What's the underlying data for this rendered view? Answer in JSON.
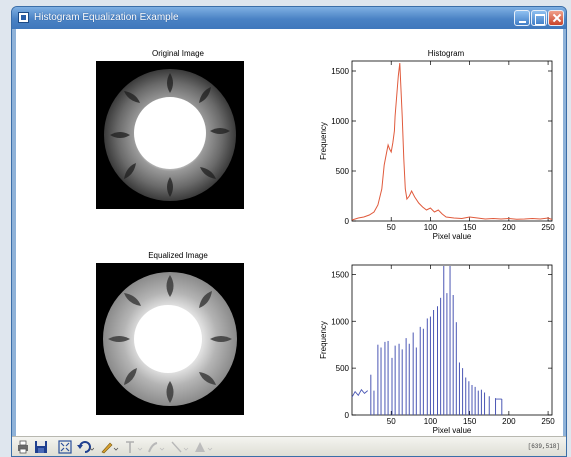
{
  "window": {
    "title": "Histogram Equalization Example",
    "titlebar_color": "#4a82c4"
  },
  "images": {
    "original_title": "Original Image",
    "equalized_title": "Equalized Image"
  },
  "chart_data": [
    {
      "type": "line",
      "title": "Histogram",
      "xlabel": "Pixel value",
      "ylabel": "Frequency",
      "xlim": [
        0,
        255
      ],
      "ylim": [
        0,
        1600
      ],
      "xticks": [
        50,
        100,
        150,
        200,
        250
      ],
      "yticks": [
        0,
        500,
        1000,
        1500
      ],
      "color": "#e05a3c",
      "x": [
        0,
        8,
        15,
        22,
        28,
        33,
        38,
        41,
        44,
        46,
        48,
        50,
        52,
        54,
        55,
        57,
        59,
        61,
        62,
        64,
        66,
        68,
        70,
        73,
        76,
        80,
        85,
        90,
        95,
        100,
        105,
        110,
        115,
        120,
        130,
        140,
        150,
        160,
        170,
        180,
        190,
        200,
        210,
        220,
        230,
        240,
        250,
        255
      ],
      "y": [
        10,
        30,
        40,
        60,
        90,
        160,
        320,
        560,
        680,
        760,
        720,
        690,
        780,
        900,
        1050,
        1250,
        1450,
        1580,
        1400,
        1050,
        620,
        320,
        220,
        250,
        300,
        240,
        180,
        140,
        110,
        130,
        90,
        110,
        70,
        40,
        30,
        25,
        40,
        30,
        20,
        25,
        20,
        25,
        18,
        20,
        25,
        20,
        30,
        15
      ]
    },
    {
      "type": "bar",
      "title": "",
      "xlabel": "Pixel value",
      "ylabel": "Frequency",
      "xlim": [
        0,
        255
      ],
      "ylim": [
        0,
        1600
      ],
      "xticks": [
        50,
        100,
        150,
        200,
        250
      ],
      "yticks": [
        0,
        500,
        1000,
        1500
      ],
      "color": "#4a56b4",
      "baseline_x": [
        0,
        4,
        8,
        12,
        16,
        20
      ],
      "baseline_y": [
        190,
        250,
        210,
        270,
        230,
        260
      ],
      "spike_x": [
        24,
        28,
        33,
        37,
        42,
        46,
        51,
        55,
        60,
        64,
        69,
        73,
        78,
        82,
        87,
        91,
        96,
        100,
        104,
        109,
        113,
        117,
        121,
        125,
        129,
        133,
        137,
        141,
        145,
        149,
        153,
        157,
        161,
        165,
        169,
        175,
        183,
        191
      ],
      "spike_y": [
        430,
        260,
        750,
        720,
        780,
        790,
        610,
        740,
        760,
        700,
        820,
        760,
        880,
        720,
        940,
        920,
        1030,
        1050,
        1120,
        1160,
        1250,
        1590,
        1300,
        1590,
        1280,
        990,
        560,
        500,
        400,
        360,
        320,
        300,
        260,
        270,
        240,
        200,
        180,
        170
      ]
    }
  ],
  "toolbar": {
    "icons": [
      "print-icon",
      "save-icon",
      "fit-icon",
      "undo-icon",
      "pencil-icon",
      "text-icon",
      "brush-icon",
      "line-icon",
      "shape-icon"
    ],
    "coords": "[639,518]"
  }
}
